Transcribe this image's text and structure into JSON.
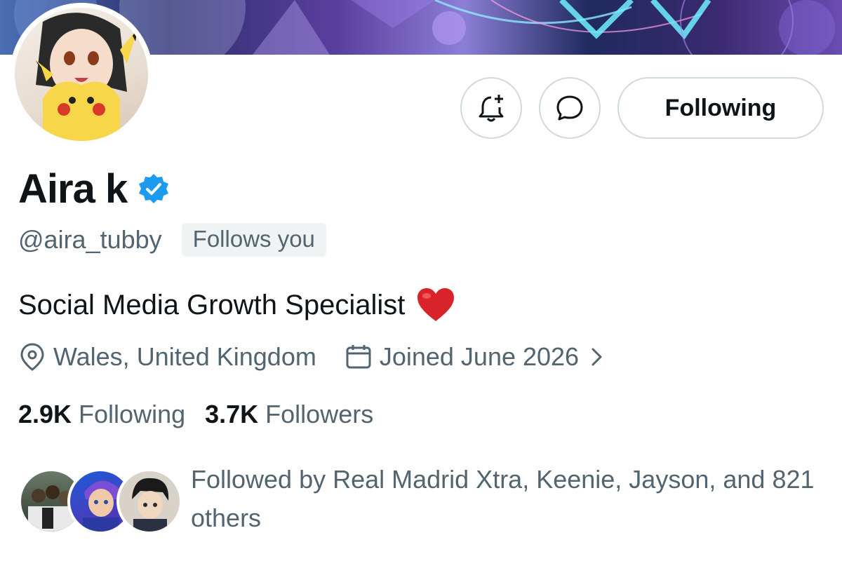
{
  "profile": {
    "name": "Aira k",
    "handle": "@aira_tubby",
    "follows_you": "Follows you",
    "bio": "Social Media Growth Specialist",
    "location": "Wales, United Kingdom",
    "joined": "Joined June 2026",
    "following_count": "2.9K",
    "following_label": "Following",
    "followers_count": "3.7K",
    "followers_label": "Followers",
    "followed_by": "Followed by Real Madrid Xtra, Keenie, Jayson, and 821 others"
  },
  "actions": {
    "notify_icon": "bell-plus-icon",
    "message_icon": "message-icon",
    "following_label": "Following"
  },
  "icons": {
    "verified": "verified-badge-icon",
    "heart": "red-heart-emoji",
    "location": "location-pin-icon",
    "calendar": "calendar-icon",
    "chevron": "chevron-right-icon"
  },
  "colors": {
    "primary_text": "#0f1419",
    "secondary_text": "#536471",
    "border": "#cfd9de",
    "verified": "#1d9bf0",
    "badge_bg": "#eff3f4"
  }
}
